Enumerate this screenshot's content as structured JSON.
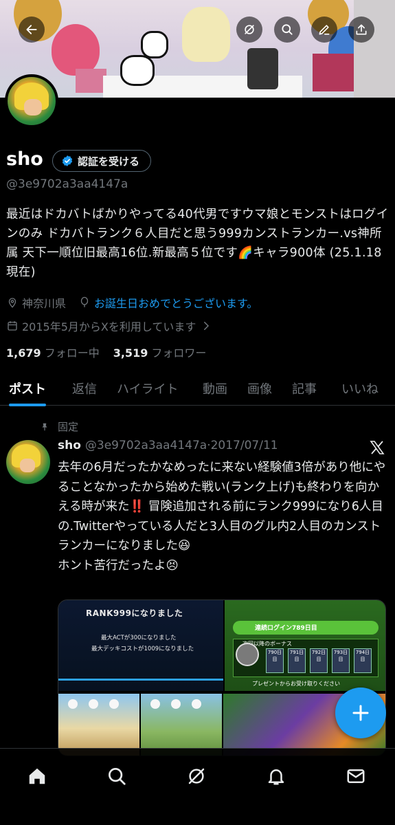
{
  "header": {
    "back_icon": "arrow-left-icon",
    "grok_icon": "grok-icon",
    "search_icon": "search-icon",
    "edit_icon": "pen-icon",
    "share_icon": "share-icon"
  },
  "profile": {
    "name": "sho",
    "verify_label": "認証を受ける",
    "handle": "@3e9702a3aa4147a",
    "bio": "最近はドカバトばかりやってる40代男ですウマ娘とモンストはログインのみ ドカバトランク６人目だと思う999カンストランカー.vs神所属 天下一順位旧最高16位.新最高５位です🌈キャラ900体 (25.1.18現在)",
    "location": "神奈川県",
    "birthday_text": "お誕生日おめでとうございます。",
    "joined": "2015年5月からXを利用しています",
    "following_count": "1,679",
    "following_label": "フォロー中",
    "followers_count": "3,519",
    "followers_label": "フォロワー"
  },
  "tabs": [
    {
      "label": "ポスト",
      "active": true
    },
    {
      "label": "返信"
    },
    {
      "label": "ハイライト"
    },
    {
      "label": "動画"
    },
    {
      "label": "画像"
    },
    {
      "label": "記事"
    },
    {
      "label": "いいね"
    }
  ],
  "pinned_post": {
    "pinned_label": "固定",
    "author_name": "sho",
    "author_handle": "@3e9702a3aa4147a",
    "separator": "·",
    "date": "2017/07/11",
    "text_lines": [
      "去年の6月だったかなめったに来ない経験値3倍があり他にやることなかったから始めた戦い(ランク上げ)も終わりを向かえる時が来た‼️ 冒険追加される前にランク999になり6人目の.Twitterやっている人だと3人目のグル内2人目のカンストランカーになりました😆",
      "ホント苦行だったよ😣"
    ],
    "media": {
      "rank_title": "RANK999になりました",
      "rank_line1": "最大ACTが300になりました",
      "rank_line2": "最大デッキコストが1009になりました",
      "login_title": "連続ログイン789日目",
      "login_sub": "次回以降のボーナス",
      "login_days": [
        "790日目",
        "791日目",
        "792日目",
        "793日目",
        "794日目"
      ],
      "login_footer": "プレゼントからお受け取りください"
    }
  },
  "fab": {
    "icon": "plus-icon"
  },
  "bottom_nav": [
    "home-icon",
    "search-icon",
    "grok-icon",
    "notifications-icon",
    "messages-icon"
  ],
  "colors": {
    "accent": "#1d9bf0",
    "background": "#000000",
    "text": "#e7e9ea",
    "muted": "#71767b"
  }
}
